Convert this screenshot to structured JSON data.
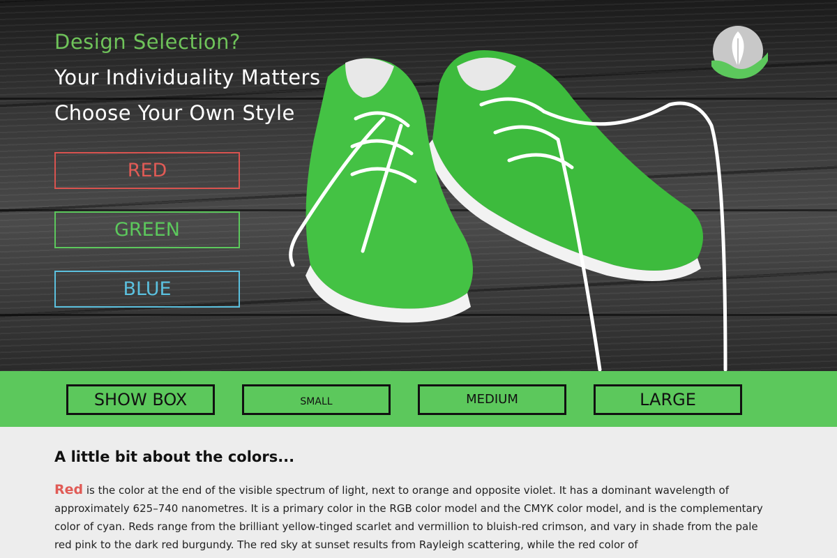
{
  "hero": {
    "lines": [
      "Design Selection?",
      "Your Individuality Matters",
      "Choose Your Own Style"
    ],
    "color_buttons": [
      "RED",
      "GREEN",
      "BLUE"
    ]
  },
  "size_bar": {
    "buttons": [
      "SHOW BOX",
      "SMALL",
      "MEDIUM",
      "LARGE"
    ]
  },
  "about": {
    "heading": "A little bit about the colors...",
    "lead_word": "Red",
    "paragraph": " is the color at the end of the visible spectrum of light, next to orange and opposite violet. It has a dominant wavelength of approximately 625–740 nanometres. It is a primary color in the RGB color model and the CMYK color model, and is the complementary color of cyan. Reds range from the brilliant yellow-tinged scarlet and vermillion to bluish-red crimson, and vary in shade from the pale red pink to the dark red burgundy. The red sky at sunset results from Rayleigh scattering, while the red color of"
  },
  "colors": {
    "red": "#e05b56",
    "green": "#5cc85c",
    "blue": "#5bc0de",
    "bar": "#5cc85c",
    "heading_accent": "#6fc35a"
  },
  "icons": {
    "logo": "leaf-hand-logo-icon"
  }
}
